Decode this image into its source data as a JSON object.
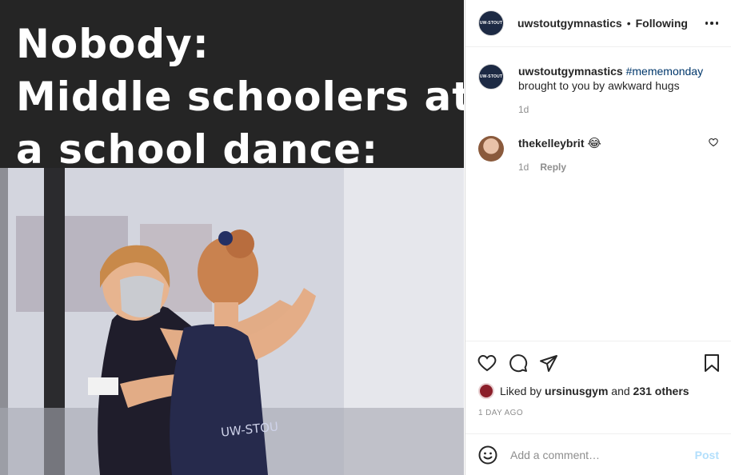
{
  "meme": {
    "lines": [
      "Nobody:",
      "Middle schoolers at",
      "a school dance:"
    ],
    "jersey_text": "UW-STOU"
  },
  "header": {
    "username": "uwstoutgymnastics",
    "separator": "•",
    "follow_status": "Following",
    "avatar_text": "UW-STOUT"
  },
  "comments": [
    {
      "username": "uwstoutgymnastics",
      "hashtag": "#mememonday",
      "text": "brought to you by awkward hugs",
      "time": "1d"
    },
    {
      "username": "thekelleybrit",
      "text": "😂",
      "time": "1d",
      "reply_label": "Reply"
    }
  ],
  "likes": {
    "prefix": "Liked by",
    "user": "ursinusgym",
    "middle": "and",
    "others": "231 others"
  },
  "date": "1 DAY AGO",
  "add_comment": {
    "placeholder": "Add a comment…",
    "post_label": "Post"
  },
  "colors": {
    "link": "#00376b",
    "muted": "#8e8e8e",
    "post_disabled": "#b2dffc"
  }
}
